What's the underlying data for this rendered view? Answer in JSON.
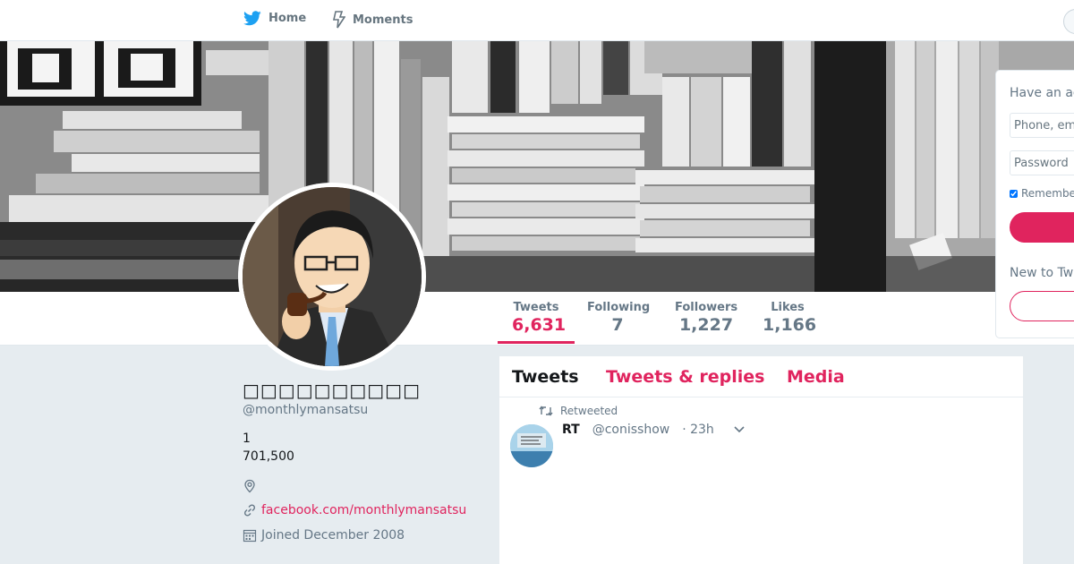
{
  "nav": {
    "home_label": "Home",
    "moments_label": "Moments"
  },
  "profile": {
    "name": "□□□□□□□□□□",
    "handle": "@monthlymansatsu",
    "bio_line1": "1",
    "bio_line2": "701,500",
    "location": "",
    "url": "facebook.com/monthlymansatsu",
    "joined": "Joined December 2008"
  },
  "stats": {
    "tweets_label": "Tweets",
    "tweets_value": "6,631",
    "following_label": "Following",
    "following_value": "7",
    "followers_label": "Followers",
    "followers_value": "1,227",
    "likes_label": "Likes",
    "likes_value": "1,166"
  },
  "timeline": {
    "tab_tweets": "Tweets",
    "tab_replies": "Tweets & replies",
    "tab_media": "Media",
    "tweet": {
      "context": "Retweeted",
      "author": "RT",
      "handle": "@conisshow",
      "time": "· 23h"
    }
  },
  "login": {
    "title": "Have an account?",
    "phone_placeholder": "Phone, email or username",
    "password_placeholder": "Password",
    "remember": "Remember me",
    "new_text": "New to Twitter?"
  },
  "colors": {
    "accent": "#e0245e",
    "twitter_blue": "#1da1f2",
    "background": "#e6ecf0"
  },
  "icons": [
    "twitter-bird-icon",
    "moments-bolt-icon",
    "location-pin-icon",
    "link-icon",
    "calendar-icon",
    "retweet-icon",
    "chevron-down-icon"
  ]
}
